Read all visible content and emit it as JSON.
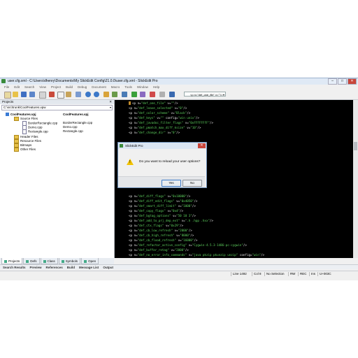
{
  "window": {
    "title": "user.cfg.xml - C:\\Users\\dhenry\\Documents\\My SlickEdit Config\\21.0.0\\user.cfg.xml - SlickEdit Pro",
    "min": "–",
    "max": "□",
    "close": "✕"
  },
  "menu": [
    "File",
    "Edit",
    "Search",
    "View",
    "Project",
    "Build",
    "Debug",
    "Document",
    "Macro",
    "Tools",
    "Window",
    "Help"
  ],
  "toolbar": {
    "path_combo": "<p n=\"def_one_file\" v=\"\"/>"
  },
  "projects_panel": {
    "title": "Projects",
    "close": "✕",
    "workspace_path": "C:\\src\\trunk\\CoolFeatures.vpw",
    "tree": [
      {
        "label": "CoolFeatures.vpj",
        "col2": "CoolFeatures.vpj",
        "bold": true,
        "type": "project"
      },
      {
        "label": "Source Files",
        "type": "folder"
      },
      {
        "label": "BorderRectangle.cpp",
        "col2": "BorderRectangle.cpp",
        "type": "file"
      },
      {
        "label": "Demo.cpp",
        "col2": "Demo.cpp",
        "type": "file"
      },
      {
        "label": "Rectangle.cpp",
        "col2": "Rectangle.cpp",
        "type": "file"
      },
      {
        "label": "Header Files",
        "type": "folder"
      },
      {
        "label": "Resource Files",
        "type": "folder"
      },
      {
        "label": "Bitmaps",
        "type": "folder"
      },
      {
        "label": "Other Files",
        "type": "folder"
      }
    ],
    "tabs": [
      "Projects",
      "Defs",
      "Class",
      "Symbols",
      "Open"
    ]
  },
  "editor": {
    "lines": [
      "<p n=\"def_one_file\" v=\"\"/>",
      "<p n=\"def_leave_selected\" v=\"0\"/>",
      "<p n=\"def_color_scheme\" v=\"Black\"/>",
      "<p n=\"def_keys\" v=\"\" config=\"win unix\"/>",
      "<p n=\"def_javadoc_filter_flags\" v=\"0xFFFFFFFF\"/>",
      "<p n=\"def_pmatch_max_diff_ksize\" v=\"10\"/>",
      "<p n=\"def_change_dir\" v=\"0\"/>",
      "<p n=\"def_diff_flags\" v=\"0x10000\"/>",
      "<p n=\"def_diff_edit_flags\" v=\"0x4050\"/>",
      "<p n=\"def_smart_diff_limit\" v=\"1000\"/>",
      "<p n=\"def_copy_flags\" v=\"0x4\"/>",
      "<p n=\"def_bgtag_options\" v=\"50 10 3\"/>",
      "<p n=\"def_add_to_prj_dep_ext\" v=\".h .hpp .hxx\"/>",
      "<p n=\"def_ctx_flags\" v=\"0x29\"/>",
      "<p n=\"def_cb_low_refresh\" v=\"2000\"/>",
      "<p n=\"def_cb_high_refresh\" v=\"8000\"/>",
      "<p n=\"def_cb_flood_refresh\" v=\"16000\"/>",
      "<p n=\"def_refactor_active_config\" v=\"Cygwin-4.5.3-1486-pc-cygwin\"/>",
      "<p n=\"def_buffer_retag\" v=\"2000\"/>",
      "<p n=\"def_no_error_info_commands\" v=\"java pkzip pkunzip unzip\" config=\"win\"/>",
      "<p n=\"def_error_info_commands\" v=\"cc javac c: grep vs make\" config=\"win\"/>",
      "<p n=\"def_autotag_flags2\" v=\"248\" config=\"unix win\"/>",
      "<p n=\"def_toolbartab\" config=\"win unix\">"
    ]
  },
  "dialog": {
    "title": "SlickEdit Pro",
    "message": "Do you want to reload your user options?",
    "yes": "Yes",
    "no": "No",
    "close": "✕",
    "warn_glyph": "!"
  },
  "bottom_tabs": [
    "Search Results",
    "Preview",
    "References",
    "Build",
    "Message List",
    "Output"
  ],
  "status": {
    "line": "Line 1492",
    "col": "Col 8",
    "selection": "No Selection",
    "rw": "RW",
    "rec": "REC",
    "ins": "Ins",
    "encoding": "U+003C"
  }
}
